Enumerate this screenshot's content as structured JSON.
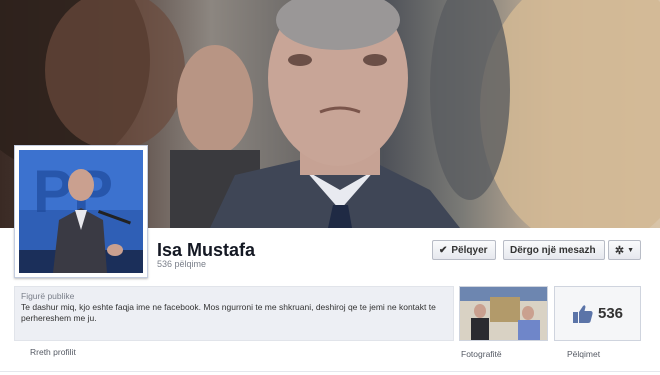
{
  "page": {
    "name": "Isa Mustafa",
    "likes_count_text": "536 pëlqime"
  },
  "actions": {
    "like_label": "Pëlqyer",
    "message_label": "Dërgo një mesazh"
  },
  "info": {
    "category": "Figurë publike",
    "about": "Te dashur miq, kjo eshte faqja ime ne facebook. Mos ngurroni te me shkruani, deshiroj qe te jemi ne kontakt te perhereshem me ju."
  },
  "tiles": {
    "about_label": "Rreth profilit",
    "photos_label": "Fotografitë",
    "likes_label": "Pëlqimet",
    "likes_number": "536"
  },
  "profile_picture_text": "PP",
  "icons": [
    "check-icon",
    "gear-icon",
    "chevron-down-icon",
    "thumbs-up-icon"
  ],
  "colors": {
    "brand": "#3b5998",
    "like_blue": "#5b74a8"
  }
}
